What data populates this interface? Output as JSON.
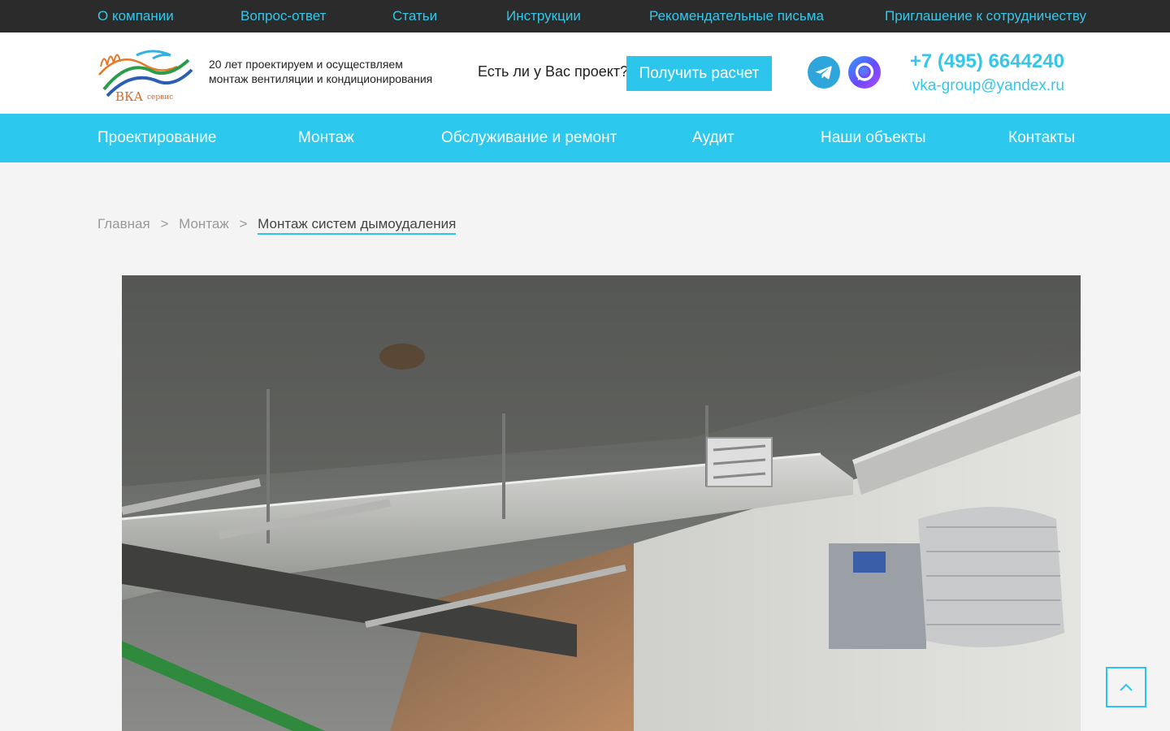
{
  "topbar": {
    "links": [
      "О компании",
      "Вопрос-ответ",
      "Статьи",
      "Инструкции",
      "Рекомендательные письма",
      "Приглашение к сотрудничеству"
    ]
  },
  "header": {
    "logo": {
      "brand": "ВКА",
      "sub": "сервис"
    },
    "tagline_line1": "20 лет проектируем и осуществляем",
    "tagline_line2": "монтаж вентиляции и кондиционирования",
    "project_question": "Есть ли у Вас проект?",
    "cta_label": "Получить расчет",
    "social": [
      "telegram-icon",
      "max-messenger-icon"
    ],
    "phone": "+7 (495) 6644240",
    "email": "vka-group@yandex.ru"
  },
  "nav": {
    "items": [
      "Проектирование",
      "Монтаж",
      "Обслуживание и ремонт",
      "Аудит",
      "Наши объекты",
      "Контакты"
    ]
  },
  "breadcrumb": {
    "home": "Главная",
    "parent": "Монтаж",
    "current": "Монтаж систем дымоудаления",
    "separator": ">"
  },
  "colors": {
    "accent": "#2cc6ec",
    "topbar_bg": "#2b2b2b",
    "page_bg": "#f4f4f4"
  },
  "icons": {
    "scroll_top": "chevron-up-icon"
  }
}
